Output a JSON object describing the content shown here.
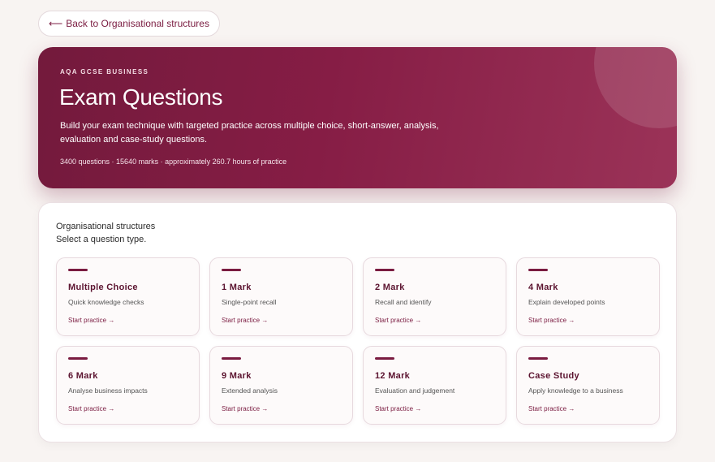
{
  "nav": {
    "back_arrow": "⟵",
    "back_label": "Back to Organisational structures"
  },
  "hero": {
    "eyebrow": "AQA GCSE BUSINESS",
    "title": "Exam Questions",
    "description": "Build your exam technique with targeted practice across multiple choice, short-answer, analysis, evaluation and case-study questions.",
    "stats": "3400 questions · 15640 marks · approximately 260.7 hours of practice"
  },
  "panel": {
    "topic": "Organisational structures",
    "instruction": "Select a question type.",
    "cards": [
      {
        "title": "Multiple Choice",
        "subtitle": "Quick knowledge checks",
        "cta": "Start practice →"
      },
      {
        "title": "1 Mark",
        "subtitle": "Single-point recall",
        "cta": "Start practice →"
      },
      {
        "title": "2 Mark",
        "subtitle": "Recall and identify",
        "cta": "Start practice →"
      },
      {
        "title": "4 Mark",
        "subtitle": "Explain developed points",
        "cta": "Start practice →"
      },
      {
        "title": "6 Mark",
        "subtitle": "Analyse business impacts",
        "cta": "Start practice →"
      },
      {
        "title": "9 Mark",
        "subtitle": "Extended analysis",
        "cta": "Start practice →"
      },
      {
        "title": "12 Mark",
        "subtitle": "Evaluation and judgement",
        "cta": "Start practice →"
      },
      {
        "title": "Case Study",
        "subtitle": "Apply knowledge to a business",
        "cta": "Start practice →"
      }
    ]
  },
  "colors": {
    "accent": "#7a1b40",
    "hero_start": "#731a3c",
    "hero_end": "#9b3358",
    "page_background": "#f8f4f2"
  }
}
